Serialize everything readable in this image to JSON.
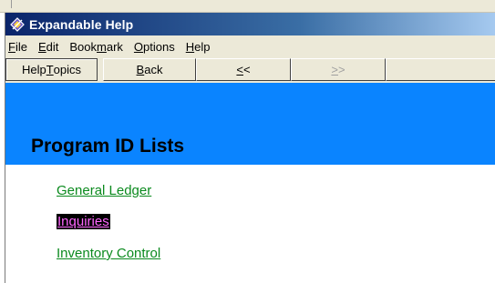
{
  "window": {
    "title": "Expandable Help",
    "title_color": "#ffffff",
    "titlebar_color": "#0a246a"
  },
  "menu": {
    "items": [
      {
        "label": "File",
        "underline": "F"
      },
      {
        "label": "Edit",
        "underline": "E"
      },
      {
        "label": "Bookmark",
        "underline": "m"
      },
      {
        "label": "Options",
        "underline": "O"
      },
      {
        "label": "Help",
        "underline": "H"
      }
    ]
  },
  "toolbar": {
    "help_topics": "Help Topics",
    "back": "Back",
    "prev": "<<",
    "next": ">>"
  },
  "content": {
    "heading_band_color": "#0a84ff",
    "page_title": "Program ID Lists",
    "links": [
      {
        "label": "General Ledger",
        "color": "#0b8a1e"
      },
      {
        "label": "Inquiries",
        "color": "#ff66ff",
        "highlight": "#000000",
        "selected": true
      },
      {
        "label": "Inventory Control",
        "color": "#0b8a1e"
      }
    ]
  }
}
